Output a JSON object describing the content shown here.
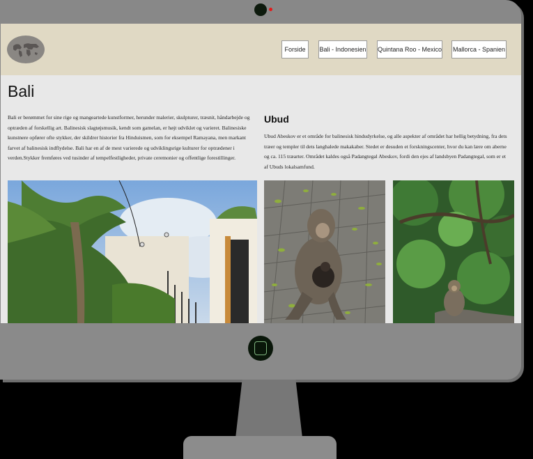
{
  "nav": {
    "items": [
      {
        "label": "Forside"
      },
      {
        "label": "Bali - Indonesien"
      },
      {
        "label": "Quintana Roo - Mexico"
      },
      {
        "label": "Mallorca - Spanien"
      }
    ]
  },
  "page": {
    "title": "Bali",
    "intro": "Bali er berømmet for sine rige og mangeartede kunstformer, herunder malerier, skulpturer, træsnit, håndarbejde og optræden af forskellig art. Balinesisk slagtøjsmusik, kendt som gamelan, er højt udviklet og varieret. Balinesiske kunstnere opfører ofte stykker, der skildrer historier fra Hinduismen, som for eksempel Ramayana, men markant farvet af balinesisk indflydelse. Bali har en af de mest varierede og udviklingsrige kulturer for optrædener i verden.Stykker fremføres ved tusinder af tempelfestligheder, private ceremonier og offentlige forestillinger."
  },
  "ubud": {
    "title": "Ubud",
    "text": "Ubud Abeskov er et område for balinesisk hindudyrkelse, og alle aspekter af området har hellig betydning, fra dets træer og templer til dets langhalede makakaber. Stedet er desuden et forskningscenter, hvor du kan lære om aberne og ca. 115 træarter. Området kaldes også Padangtegal Abeskov, fordi den ejes af landsbyen Padangtegal, som er et af Ubuds lokalsamfund."
  },
  "colors": {
    "navbar": "#e0d9c4",
    "screen_bg": "#e8e8e8",
    "monitor": "#888888",
    "camera_led": "#e21b1b",
    "home_button": "#0a170a"
  },
  "icons": [
    "world-map-logo-icon",
    "camera-icon",
    "home-button-icon"
  ]
}
